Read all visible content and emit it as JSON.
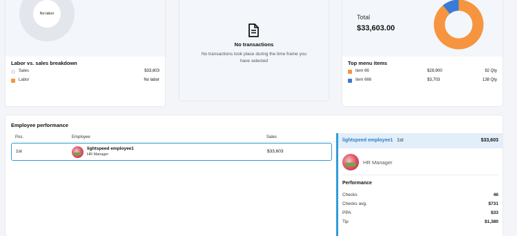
{
  "labor_card": {
    "donut_label": "No labor",
    "title": "Labor vs. sales breakdown",
    "legend": [
      {
        "label": "Sales",
        "value": "$33,603",
        "color": "#e3e8f0"
      },
      {
        "label": "Labor",
        "value": "No labor",
        "color": "#f7943f"
      }
    ]
  },
  "transactions_card": {
    "icon": "document-icon",
    "title": "No transactions",
    "message": "No transactions took place during the time frame you have selected"
  },
  "menu_card": {
    "total_label": "Total",
    "total_value": "$33,603.00",
    "title": "Top menu items",
    "items": [
      {
        "label": "item 66",
        "value": "$29,900",
        "qty": "92 Qty",
        "color": "#f7943f"
      },
      {
        "label": "item 666",
        "value": "$3,703",
        "qty": "138 Qty",
        "color": "#3a7bd5"
      }
    ],
    "chart_data": {
      "type": "pie",
      "categories": [
        "item 66",
        "item 666"
      ],
      "values": [
        29900,
        3703
      ]
    }
  },
  "employee_performance": {
    "title": "Employee performance",
    "columns": [
      "Pos.",
      "Employee",
      "Sales"
    ],
    "rows": [
      {
        "pos": "1st",
        "name": "lightspeed employee1",
        "role": "HR Manager",
        "sales": "$33,603"
      }
    ],
    "detail": {
      "name": "lightspeed employee1",
      "rank": "1st",
      "sales": "$33,603",
      "role": "HR Manager",
      "section_title": "Performance",
      "metrics": [
        {
          "label": "Checks",
          "value": "46"
        },
        {
          "label": "Checks avg.",
          "value": "$731"
        },
        {
          "label": "PPA",
          "value": "$33"
        },
        {
          "label": "Tip",
          "value": "$1,380"
        }
      ]
    }
  },
  "colors": {
    "accent": "#2f9bd6",
    "orange": "#f7943f",
    "blue": "#3a7bd5",
    "panel_bg": "#f3f6fa"
  }
}
